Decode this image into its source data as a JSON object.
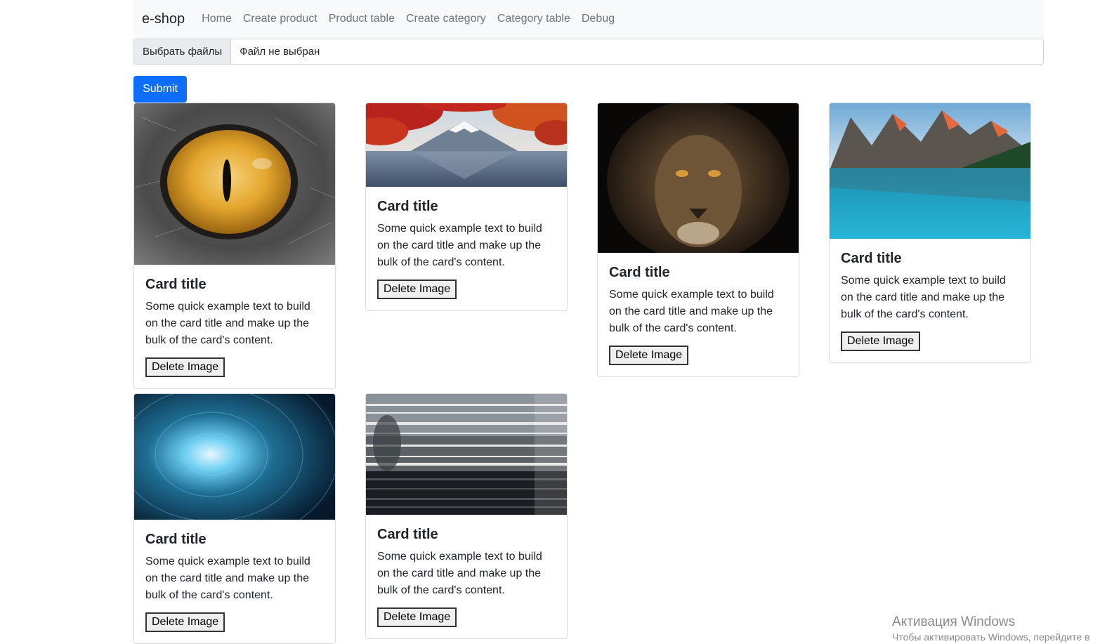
{
  "navbar": {
    "brand": "e-shop",
    "links": [
      "Home",
      "Create product",
      "Product table",
      "Create category",
      "Category table",
      "Debug"
    ]
  },
  "upload": {
    "choose_label": "Выбрать файлы",
    "file_status": "Файл не выбран",
    "submit_label": "Submit"
  },
  "cards": [
    {
      "image": "cat-eye-image",
      "title": "Card title",
      "text": "Some quick example text to build on the card title and make up the bulk of the card's content.",
      "button": "Delete Image"
    },
    {
      "image": "mountain-lake-autumn-image",
      "title": "Card title",
      "text": "Some quick example text to build on the card title and make up the bulk of the card's content.",
      "button": "Delete Image"
    },
    {
      "image": "lion-portrait-image",
      "title": "Card title",
      "text": "Some quick example text to build on the card title and make up the bulk of the card's content.",
      "button": "Delete Image"
    },
    {
      "image": "mountain-lake-image",
      "title": "Card title",
      "text": "Some quick example text to build on the card title and make up the bulk of the card's content.",
      "button": "Delete Image"
    },
    {
      "image": "binary-tunnel-image",
      "title": "Card title",
      "text": "Some quick example text to build on the card title and make up the bulk of the card's content.",
      "button": "Delete Image"
    },
    {
      "image": "glitched-landscape-image",
      "title": "Card title",
      "text": "Some quick example text to build on the card title and make up the bulk of the card's content.",
      "button": "Delete Image"
    }
  ],
  "watermark": {
    "line1": "Активация Windows",
    "line2": "Чтобы активировать Windows, перейдите в"
  },
  "colors": {
    "primary": "#0d6efd",
    "navbar_bg": "#f8f9fa",
    "nav_link": "#6c757d"
  }
}
